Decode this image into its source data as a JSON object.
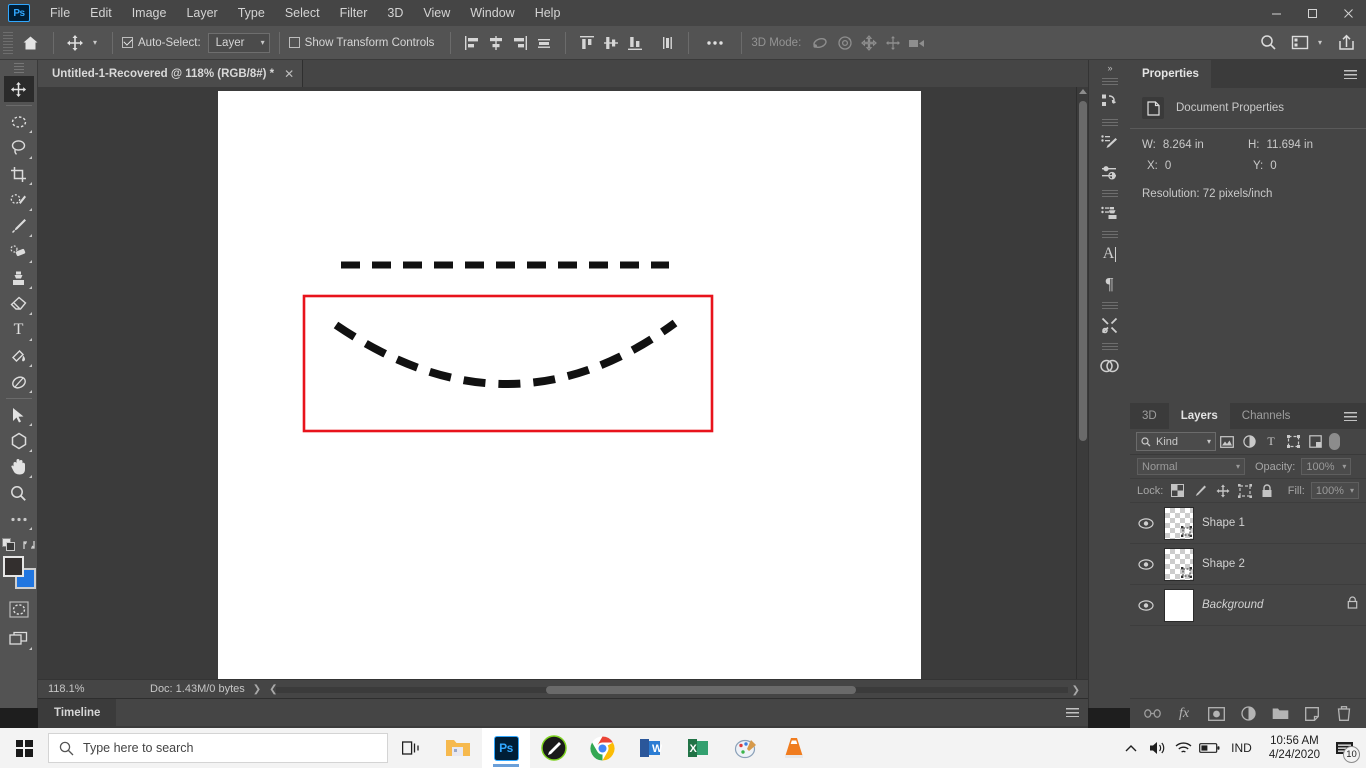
{
  "app": {
    "logo_text": "Ps",
    "window_controls": {
      "minimize": "—",
      "maximize": "❐",
      "close": "✕"
    }
  },
  "menu": {
    "items": [
      "File",
      "Edit",
      "Image",
      "Layer",
      "Type",
      "Select",
      "Filter",
      "3D",
      "View",
      "Window",
      "Help"
    ]
  },
  "options_bar": {
    "home_icon": "home-icon",
    "tool_icon": "move-tool-icon",
    "auto_select_label": "Auto-Select:",
    "auto_select_checked": true,
    "auto_select_target": "Layer",
    "show_transform_label": "Show Transform Controls",
    "show_transform_checked": false,
    "align_icons": [
      "align-left-edges",
      "align-horizontal-centers",
      "align-right-edges",
      "distribute-horizontally"
    ],
    "align_icons2": [
      "align-top-edges",
      "align-vertical-centers",
      "align-bottom-edges",
      "distribute-vertically"
    ],
    "more_label": "•••",
    "mode_3d_label": "3D Mode:",
    "mode_3d_icons": [
      "rotate-3d-icon",
      "roll-3d-icon",
      "drag-3d-icon",
      "slide-3d-icon",
      "scale-3d-icon"
    ],
    "right_icons": [
      "search-icon",
      "workspace-icon",
      "chevron-down-icon",
      "share-icon"
    ]
  },
  "toolbar": {
    "tools": [
      {
        "name": "move-tool",
        "glyph": "✥",
        "active": true,
        "has_flyout": false
      },
      {
        "name": "marquee-tool",
        "glyph": "◌",
        "active": false,
        "has_flyout": true
      },
      {
        "name": "lasso-tool",
        "glyph": "◯",
        "active": false,
        "has_flyout": true
      },
      {
        "name": "crop-tool",
        "glyph": "⌗",
        "active": false,
        "has_flyout": true
      },
      {
        "name": "quick-selection-tool",
        "glyph": "✎",
        "active": false,
        "has_flyout": true
      },
      {
        "name": "brush-tool",
        "glyph": "✏",
        "active": false,
        "has_flyout": true
      },
      {
        "name": "healing-brush-tool",
        "glyph": "✚",
        "active": false,
        "has_flyout": true
      },
      {
        "name": "clone-stamp-tool",
        "glyph": "⎈",
        "active": false,
        "has_flyout": true
      },
      {
        "name": "eraser-tool",
        "glyph": "◨",
        "active": false,
        "has_flyout": true
      },
      {
        "name": "type-tool",
        "glyph": "T",
        "active": false,
        "has_flyout": true
      },
      {
        "name": "gradient-tool",
        "glyph": "▰",
        "active": false,
        "has_flyout": true
      },
      {
        "name": "pen-tool",
        "glyph": "✒",
        "active": false,
        "has_flyout": true
      },
      {
        "name": "path-selection-tool",
        "glyph": "➤",
        "active": false,
        "has_flyout": true
      },
      {
        "name": "shape-tool",
        "glyph": "⬡",
        "active": false,
        "has_flyout": true
      },
      {
        "name": "hand-tool",
        "glyph": "✋",
        "active": false,
        "has_flyout": true
      },
      {
        "name": "zoom-tool",
        "glyph": "🔍",
        "active": false,
        "has_flyout": true
      },
      {
        "name": "edit-toolbar",
        "glyph": "•••",
        "active": false,
        "has_flyout": true
      }
    ],
    "foreground_color": "#332f2e",
    "background_color": "#2176e0",
    "quick_mask_name": "quick-mask-icon",
    "screen_mode_name": "screen-mode-icon"
  },
  "document": {
    "tab_title": "Untitled-1-Recovered @ 118% (RGB/8#) *",
    "close_glyph": "✕"
  },
  "status_bar": {
    "zoom": "118.1%",
    "doc_info": "Doc: 1.43M/0 bytes",
    "right_arrow": "❯",
    "left_arrow": "❮"
  },
  "timeline": {
    "tab_label": "Timeline"
  },
  "icon_dock": {
    "collapse_glyph": "»",
    "groups": [
      [
        {
          "name": "history-icon"
        }
      ],
      [
        {
          "name": "brush-settings-icon"
        },
        {
          "name": "adjustments-icon"
        }
      ],
      [
        {
          "name": "clone-source-icon"
        }
      ],
      [
        {
          "name": "character-panel-icon",
          "glyph": "A"
        },
        {
          "name": "paragraph-panel-icon",
          "glyph": "¶"
        }
      ],
      [
        {
          "name": "tool-presets-icon"
        }
      ],
      [
        {
          "name": "cc-libraries-icon"
        }
      ]
    ]
  },
  "properties": {
    "tabs": [
      {
        "label": "Properties",
        "active": true
      }
    ],
    "header_title": "Document Properties",
    "fields": [
      {
        "key": "W:",
        "value": "8.264 in"
      },
      {
        "key": "H:",
        "value": "11.694 in"
      },
      {
        "key": "X:",
        "value": "0"
      },
      {
        "key": "Y:",
        "value": "0"
      }
    ],
    "resolution": "Resolution: 72 pixels/inch"
  },
  "layers_panel": {
    "tabs": [
      {
        "label": "3D",
        "active": false
      },
      {
        "label": "Layers",
        "active": true
      },
      {
        "label": "Channels",
        "active": false
      }
    ],
    "filter_select": "Kind",
    "filter_icons": [
      "filter-pixel-icon",
      "filter-adjustment-icon",
      "filter-type-icon",
      "filter-shape-icon",
      "filter-smart-object-icon"
    ],
    "blend_mode": "Normal",
    "opacity_label": "Opacity:",
    "opacity_value": "100%",
    "lock_label": "Lock:",
    "lock_icons": [
      "lock-transparent-pixels-icon",
      "lock-image-pixels-icon",
      "lock-position-icon",
      "lock-artboard-icon",
      "lock-all-icon"
    ],
    "fill_label": "Fill:",
    "fill_value": "100%",
    "layers": [
      {
        "name": "Shape 1",
        "visible": true,
        "type": "shape",
        "locked": false,
        "italic": false
      },
      {
        "name": "Shape 2",
        "visible": true,
        "type": "shape",
        "locked": false,
        "italic": false
      },
      {
        "name": "Background",
        "visible": true,
        "type": "background",
        "locked": true,
        "italic": true
      }
    ],
    "bottom_icons": [
      "link-layers-icon",
      "layer-style-icon",
      "layer-mask-icon",
      "adjustment-layer-icon",
      "new-group-icon",
      "new-layer-icon",
      "delete-layer-icon"
    ]
  },
  "canvas": {
    "artwork_description": "dashed straight line above a red rectangle containing a dashed concave curve",
    "rect_stroke_color": "#e8131c",
    "dash_color": "#111111"
  },
  "taskbar": {
    "search_placeholder": "Type here to search",
    "apps": [
      {
        "name": "file-explorer",
        "active": false,
        "open": true
      },
      {
        "name": "photoshop",
        "active": true,
        "open": true
      },
      {
        "name": "snip-tool",
        "active": false,
        "open": false
      },
      {
        "name": "google-chrome",
        "active": false,
        "open": true
      },
      {
        "name": "microsoft-word",
        "active": false,
        "open": true
      },
      {
        "name": "microsoft-excel",
        "active": false,
        "open": false
      },
      {
        "name": "paint",
        "active": false,
        "open": false
      },
      {
        "name": "vlc-media-player",
        "active": false,
        "open": false
      }
    ],
    "tray": {
      "language": "IND",
      "time": "10:56 AM",
      "date": "4/24/2020",
      "notification_count": "10"
    }
  }
}
